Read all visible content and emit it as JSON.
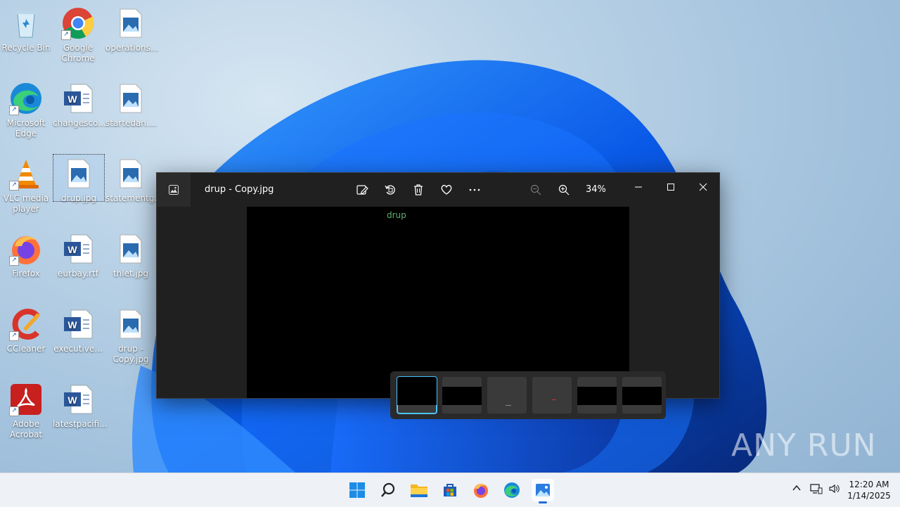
{
  "desktop": {
    "icons": [
      {
        "label": "Recycle Bin"
      },
      {
        "label": "Google Chrome"
      },
      {
        "label": "operations..."
      },
      {
        "label": "Microsoft Edge"
      },
      {
        "label": "changesco..."
      },
      {
        "label": "startedan...."
      },
      {
        "label": "VLC media player"
      },
      {
        "label": "drup.jpg"
      },
      {
        "label": "statementg..."
      },
      {
        "label": "Firefox"
      },
      {
        "label": "eurbay.rtf"
      },
      {
        "label": "thlet.jpg"
      },
      {
        "label": "CCleaner"
      },
      {
        "label": "executive..."
      },
      {
        "label": "drup - Copy.jpg"
      },
      {
        "label": "Adobe Acrobat"
      },
      {
        "label": "latestpacifi..."
      }
    ]
  },
  "photos_window": {
    "title": "drup - Copy.jpg",
    "zoom": "34%",
    "image_text": "drup",
    "toolbar_icons": [
      "edit-image-icon",
      "rotate-icon",
      "delete-icon",
      "favorite-icon",
      "more-icon",
      "zoom-out-icon",
      "zoom-in-icon"
    ],
    "thumbnail_count": 6
  },
  "taskbar": {
    "apps": [
      "start-icon",
      "search-icon",
      "file-explorer-icon",
      "store-icon",
      "firefox-icon",
      "edge-icon",
      "photos-icon"
    ]
  },
  "clock": {
    "time": "12:20 AM",
    "date": "1/14/2025"
  },
  "watermark": "ANY RUN",
  "colors": {
    "accent": "#4cc2ff",
    "window_bg": "#202020",
    "taskbar_bg": "#eef1f6"
  }
}
